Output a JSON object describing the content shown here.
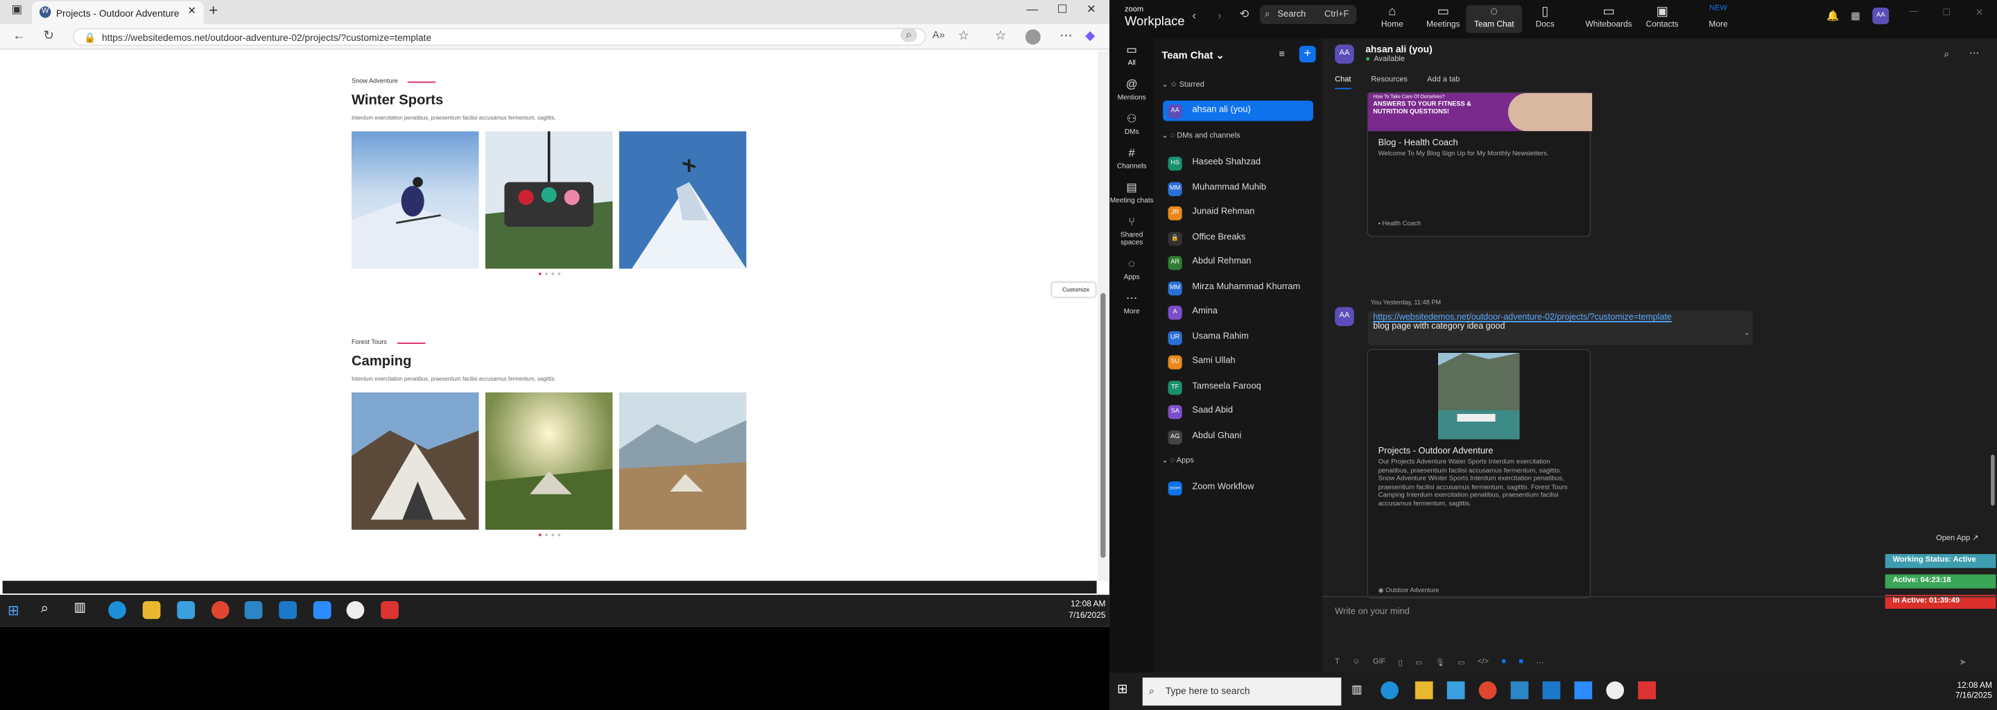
{
  "browser": {
    "tab_title": "Projects - Outdoor Adventure",
    "url": "https://websitedemos.net/outdoor-adventure-02/projects/?customize=template",
    "customize_label": "Customize"
  },
  "page": {
    "sections": [
      {
        "kicker": "Snow Adventure",
        "heading": "Winter Sports",
        "text": "Interdum exercitation penatibus, praesentium facilisi accusamus fermentum, sagittis."
      },
      {
        "kicker": "Forest Tours",
        "heading": "Camping",
        "text": "Interdum exercitation penatibus, praesentium facilisi accusamus fermentum, sagittis."
      }
    ]
  },
  "left_taskbar": {
    "time": "12:08 AM",
    "date": "7/16/2025"
  },
  "zoom": {
    "logo_top": "zoom",
    "logo_bottom": "Workplace",
    "search_label": "Search",
    "search_shortcut": "Ctrl+F",
    "nav": [
      {
        "label": "Home",
        "icon": "home-icon"
      },
      {
        "label": "Meetings",
        "icon": "video-icon"
      },
      {
        "label": "Team Chat",
        "icon": "chat-icon"
      },
      {
        "label": "Docs",
        "icon": "doc-icon"
      },
      {
        "label": "Whiteboards",
        "icon": "whiteboard-icon"
      },
      {
        "label": "Contacts",
        "icon": "contacts-icon"
      },
      {
        "label": "More",
        "icon": "more-icon",
        "badge": "NEW"
      }
    ],
    "rail": [
      {
        "label": "All"
      },
      {
        "label": "Mentions"
      },
      {
        "label": "DMs"
      },
      {
        "label": "Channels"
      },
      {
        "label": "Meeting chats"
      },
      {
        "label": "Shared spaces"
      },
      {
        "label": "Apps"
      },
      {
        "label": "More"
      }
    ],
    "panel_title": "Team Chat",
    "starred_label": "Starred",
    "dms_label": "DMs and channels",
    "apps_label": "Apps",
    "self_contact": {
      "initials": "AA",
      "name": "ahsan ali (you)"
    },
    "contacts": [
      {
        "initials": "HS",
        "name": "Haseeb Shahzad",
        "color": "#1a8f6e"
      },
      {
        "initials": "MM",
        "name": "Muhammad Muhib",
        "color": "#2a6fd6"
      },
      {
        "initials": "JR",
        "name": "Junaid Rehman",
        "color": "#e8871a"
      },
      {
        "initials": "🔒",
        "name": "Office Breaks",
        "color": "#333333"
      },
      {
        "initials": "AR",
        "name": "Abdul Rehman",
        "color": "#2e7d32"
      },
      {
        "initials": "MM",
        "name": "Mirza Muhammad Khurram",
        "color": "#2a6fd6"
      },
      {
        "initials": "A",
        "name": "Amina",
        "color": "#7b4fc9"
      },
      {
        "initials": "UR",
        "name": "Usama Rahim",
        "color": "#2a6fd6"
      },
      {
        "initials": "SU",
        "name": "Sami Ullah",
        "color": "#e8871a"
      },
      {
        "initials": "TF",
        "name": "Tamseela Farooq",
        "color": "#1a8f6e"
      },
      {
        "initials": "SA",
        "name": "Saad Abid",
        "color": "#7b4fc9"
      },
      {
        "initials": "AG",
        "name": "Abdul Ghani",
        "color": "#444444"
      }
    ],
    "app_item": {
      "initials": "zoom",
      "name": "Zoom Workflow"
    },
    "chat_header": {
      "initials": "AA",
      "name": "ahsan ali (you)",
      "status": "Available"
    },
    "tabs": [
      "Chat",
      "Resources",
      "Add a tab"
    ],
    "card1": {
      "banner_small": "How To Take Care Of Ourselves?",
      "banner_big": "ANSWERS TO YOUR FITNESS & NUTRITION QUESTIONS!",
      "title": "Blog - Health Coach",
      "desc": "Welcome To My Blog Sign Up for My Monthly Newsletters.",
      "footer": "Health Coach"
    },
    "message": {
      "sender": "You",
      "time": "Yesterday, 11:48 PM",
      "link": "https://websitedemos.net/outdoor-adventure-02/projects/?customize=template",
      "text": "blog page with category idea good"
    },
    "card2": {
      "title": "Projects - Outdoor Adventure",
      "desc": "Our Projects Adventure Water Sports Interdum exercitation penatibus, praesentium facilisi accusamus fermentum, sagittis. Snow Adventure Winter Sports Interdum exercitation penatibus, praesentium facilisi accusamus fermentum, sagittis. Forest Tours Camping Interdum exercitation penatibus, praesentium facilisi accusamus fermentum, sagittis.",
      "footer": "Outdoor Adventure"
    },
    "compose_placeholder": "Write on your mind",
    "open_app": "Open App ↗",
    "working_status": "Working Status: Active",
    "active_time": "Active: 04:23:18",
    "inactive_time": "In Active: 01:39:49",
    "colors": {
      "accent": "#0e72ed",
      "status_active": "#3aa657",
      "status_inactive": "#d9302b",
      "status_header": "#3f9db0"
    }
  },
  "right_taskbar": {
    "search_placeholder": "Type here to search",
    "time": "12:08 AM",
    "date": "7/16/2025"
  }
}
